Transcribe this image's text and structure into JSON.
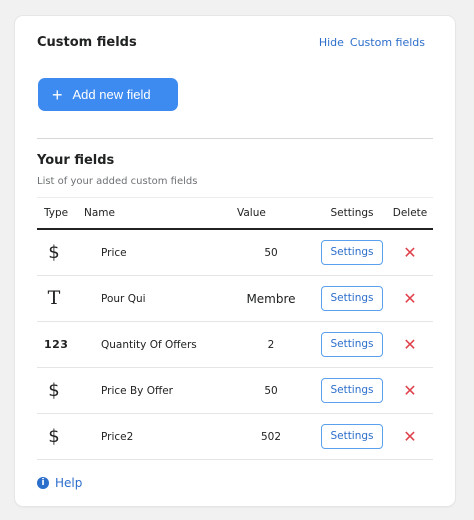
{
  "header": {
    "title": "Custom fields",
    "hide_link": "Hide",
    "custom_fields_link": "Custom fields"
  },
  "add_button": {
    "icon": "plus-icon",
    "label": "Add new field"
  },
  "section": {
    "title": "Your fields",
    "subtitle": "List of your added custom fields"
  },
  "table": {
    "columns": [
      "Type",
      "Name",
      "Value",
      "Settings",
      "Delete"
    ],
    "rows": [
      {
        "type_icon": "dollar-icon",
        "type_glyph": "$",
        "name": "Price",
        "value": "50",
        "settings_label": "Settings"
      },
      {
        "type_icon": "text-icon",
        "type_glyph": "T",
        "name": "Pour Qui",
        "value": "Membre",
        "settings_label": "Settings"
      },
      {
        "type_icon": "number-icon",
        "type_glyph": "123",
        "name": "Quantity Of Offers",
        "value": "2",
        "settings_label": "Settings"
      },
      {
        "type_icon": "dollar-icon",
        "type_glyph": "$",
        "name": "Price By Offer",
        "value": "50",
        "settings_label": "Settings"
      },
      {
        "type_icon": "dollar-icon",
        "type_glyph": "$",
        "name": "Price2",
        "value": "502",
        "settings_label": "Settings"
      }
    ],
    "delete_glyph": "✕"
  },
  "help": {
    "icon": "info-icon",
    "label": "Help"
  },
  "colors": {
    "accent": "#3d8af1",
    "link": "#2c6ecb",
    "delete": "#e0424b"
  }
}
